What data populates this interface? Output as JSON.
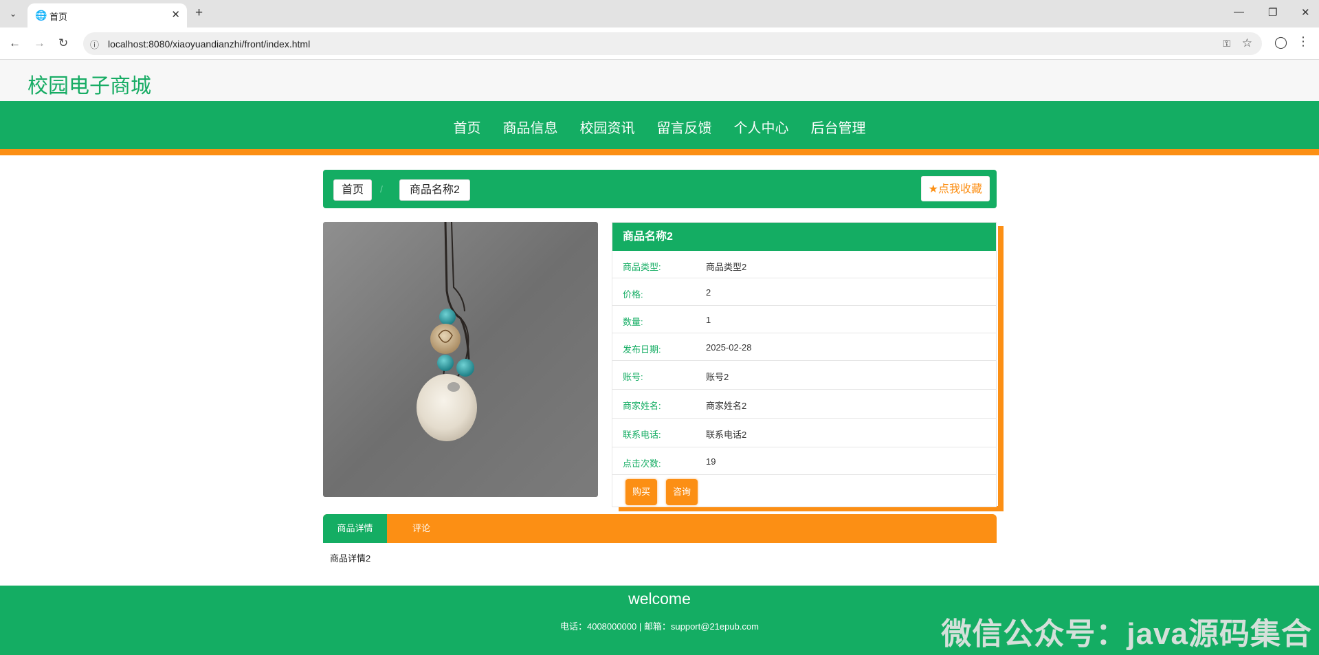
{
  "browser": {
    "tab_title": "首页",
    "url": "localhost:8080/xiaoyuandianzhi/front/index.html"
  },
  "site": {
    "logo": "校园电子商城",
    "nav": [
      "首页",
      "商品信息",
      "校园资讯",
      "留言反馈",
      "个人中心",
      "后台管理"
    ]
  },
  "breadcrumb": {
    "home": "首页",
    "separator": "/",
    "current": "商品名称2",
    "favorite": "点我收藏"
  },
  "product": {
    "name": "商品名称2",
    "fields": [
      {
        "label": "商品类型:",
        "value": "商品类型2"
      },
      {
        "label": "价格:",
        "value": "2"
      },
      {
        "label": "数量:",
        "value": "1"
      },
      {
        "label": "发布日期:",
        "value": "2025-02-28"
      },
      {
        "label": "账号:",
        "value": "账号2"
      },
      {
        "label": "商家姓名:",
        "value": "商家姓名2"
      },
      {
        "label": "联系电话:",
        "value": "联系电话2"
      },
      {
        "label": "点击次数:",
        "value": "19"
      }
    ],
    "buy": "购买",
    "consult": "咨询"
  },
  "detail_tabs": {
    "details": "商品详情",
    "comments": "评论",
    "content": "商品详情2"
  },
  "footer": {
    "welcome": "welcome",
    "contact": "电话：4008000000 | 邮箱：support@21epub.com"
  },
  "watermark": "微信公众号：java源码集合",
  "colors": {
    "primary": "#14ad63",
    "accent": "#fc8f14"
  }
}
